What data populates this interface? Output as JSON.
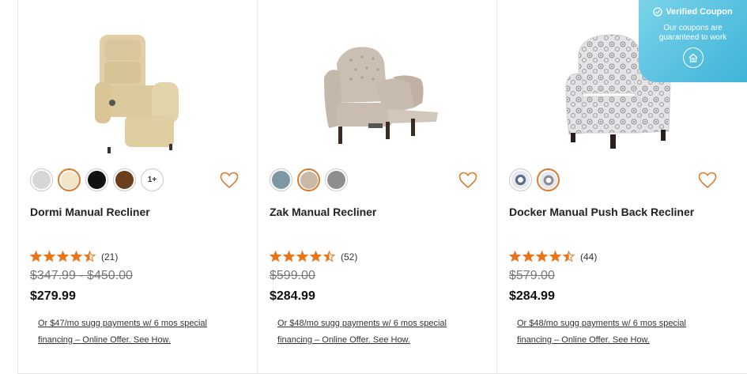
{
  "accent_color": "#d97b2e",
  "products": [
    {
      "name": "Dormi Manual Recliner",
      "rating_count": "(21)",
      "rating": 4.5,
      "was_price": "$347.99 - $450.00",
      "price": "$279.99",
      "finance_line1": "Or $47/mo sugg payments w/ 6 mos special",
      "finance_line2": "financing – Online Offer. See How.",
      "swatches": [
        "#d6d6d6",
        "#f3e5c8",
        "#111111",
        "#6b3f1c"
      ],
      "swatch_more_label": "1+"
    },
    {
      "name": "Zak Manual Recliner",
      "rating_count": "(52)",
      "rating": 4.5,
      "was_price": "$599.00",
      "price": "$284.99",
      "finance_line1": "Or $48/mo sugg payments w/ 6 mos special",
      "finance_line2": "financing – Online Offer. See How.",
      "swatches": [
        "#7d97a3",
        "#c9b9a8",
        "#8e8e8e"
      ]
    },
    {
      "name": "Docker Manual Push Back Recliner",
      "rating_count": "(44)",
      "rating": 4.5,
      "was_price": "$579.00",
      "price": "$284.99",
      "finance_line1": "Or $48/mo sugg payments w/ 6 mos special",
      "finance_line2": "financing – Online Offer. See How.",
      "swatches": [
        "#5d6d8a",
        "#8c8c96"
      ]
    }
  ],
  "coupon": {
    "title": "Verified Coupon",
    "subtitle_line1": "Our coupons are",
    "subtitle_line2": "guaranteed to work"
  }
}
